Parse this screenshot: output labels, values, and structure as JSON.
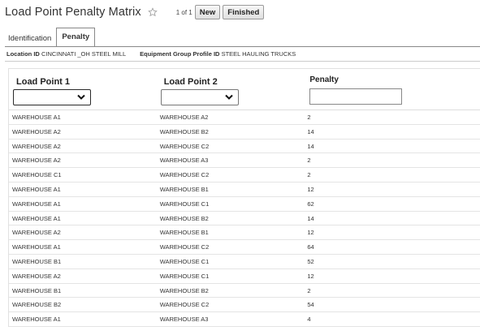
{
  "header": {
    "title": "Load Point Penalty Matrix",
    "pager": "1 of 1",
    "new_label": "New",
    "finished_label": "Finished"
  },
  "tabs": [
    {
      "label": "Identification",
      "active": false
    },
    {
      "label": "Penalty",
      "active": true
    }
  ],
  "info": {
    "location_label": "Location ID",
    "location_value": "CINCINNATI _OH STEEL MILL",
    "equipment_label": "Equipment Group Profile ID",
    "equipment_value": "STEEL HAULING TRUCKS"
  },
  "columns": {
    "load_point_1": "Load Point 1",
    "load_point_2": "Load Point 2",
    "penalty": "Penalty"
  },
  "filters": {
    "load_point_1_value": "",
    "load_point_2_value": "",
    "penalty_value": ""
  },
  "rows": [
    [
      "WAREHOUSE A1",
      "WAREHOUSE A2",
      "2"
    ],
    [
      "WAREHOUSE A2",
      "WAREHOUSE B2",
      "14"
    ],
    [
      "WAREHOUSE A2",
      "WAREHOUSE C2",
      "14"
    ],
    [
      "WAREHOUSE A2",
      "WAREHOUSE A3",
      "2"
    ],
    [
      "WAREHOUSE C1",
      "WAREHOUSE C2",
      "2"
    ],
    [
      "WAREHOUSE A1",
      "WAREHOUSE B1",
      "12"
    ],
    [
      "WAREHOUSE A1",
      "WAREHOUSE C1",
      "62"
    ],
    [
      "WAREHOUSE A1",
      "WAREHOUSE B2",
      "14"
    ],
    [
      "WAREHOUSE A2",
      "WAREHOUSE B1",
      "12"
    ],
    [
      "WAREHOUSE A1",
      "WAREHOUSE C2",
      "64"
    ],
    [
      "WAREHOUSE B1",
      "WAREHOUSE C1",
      "52"
    ],
    [
      "WAREHOUSE A2",
      "WAREHOUSE C1",
      "12"
    ],
    [
      "WAREHOUSE B1",
      "WAREHOUSE B2",
      "2"
    ],
    [
      "WAREHOUSE B2",
      "WAREHOUSE C2",
      "54"
    ],
    [
      "WAREHOUSE A1",
      "WAREHOUSE A3",
      "4"
    ]
  ]
}
